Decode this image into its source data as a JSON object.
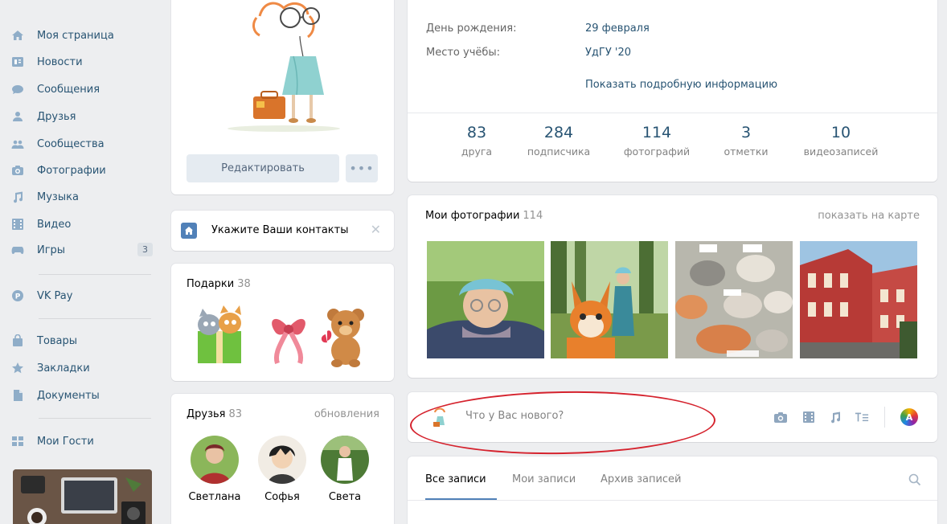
{
  "sidebar": {
    "items": [
      {
        "label": "Моя страница",
        "icon": "home-icon"
      },
      {
        "label": "Новости",
        "icon": "news-icon"
      },
      {
        "label": "Сообщения",
        "icon": "messages-icon"
      },
      {
        "label": "Друзья",
        "icon": "friends-icon"
      },
      {
        "label": "Сообщества",
        "icon": "groups-icon"
      },
      {
        "label": "Фотографии",
        "icon": "camera-icon"
      },
      {
        "label": "Музыка",
        "icon": "music-icon"
      },
      {
        "label": "Видео",
        "icon": "video-icon"
      },
      {
        "label": "Игры",
        "icon": "games-icon",
        "count": "3"
      },
      {
        "label": "VK Pay",
        "icon": "vkpay-icon"
      },
      {
        "label": "Товары",
        "icon": "shopping-bag-icon"
      },
      {
        "label": "Закладки",
        "icon": "star-icon"
      },
      {
        "label": "Документы",
        "icon": "document-icon"
      },
      {
        "label": "Мои Гости",
        "icon": "guests-app-icon"
      }
    ]
  },
  "profile": {
    "edit_label": "Редактировать",
    "more_label": "•••"
  },
  "contacts": {
    "label": "Укажите Ваши контакты",
    "close": "✕"
  },
  "gifts": {
    "title": "Подарки",
    "count": "38"
  },
  "friends": {
    "title": "Друзья",
    "count": "83",
    "updates": "обновления",
    "list": [
      {
        "name": "Светлана"
      },
      {
        "name": "Софья"
      },
      {
        "name": "Света"
      }
    ]
  },
  "info": {
    "birthday_label": "День рождения:",
    "birthday_value": "29 февраля",
    "study_label": "Место учёбы:",
    "study_value": "УдГУ '20",
    "show_more": "Показать подробную информацию",
    "counters": [
      {
        "n": "83",
        "l": "друга"
      },
      {
        "n": "284",
        "l": "подписчика"
      },
      {
        "n": "114",
        "l": "фотографий"
      },
      {
        "n": "3",
        "l": "отметки"
      },
      {
        "n": "10",
        "l": "видеозаписей"
      }
    ]
  },
  "photos": {
    "title": "Мои фотографии",
    "count": "114",
    "map_link": "показать на карте"
  },
  "post": {
    "placeholder": "Что у Вас нового?"
  },
  "wall": {
    "tabs": [
      "Все записи",
      "Мои записи",
      "Архив записей"
    ]
  },
  "colors": {
    "link": "#285473",
    "accent": "#5181b8",
    "background": "#edeef0",
    "annotation_red": "#d5232e"
  }
}
